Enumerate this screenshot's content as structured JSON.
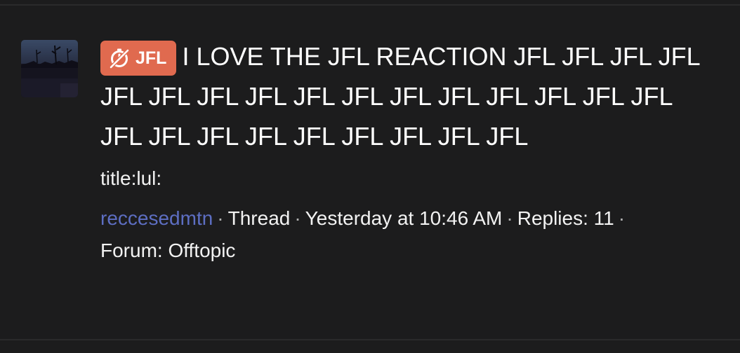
{
  "thread": {
    "prefix": {
      "label": "JFL",
      "icon": "stopwatch-slash-icon",
      "color": "#e06a4f"
    },
    "title": "I LOVE THE JFL REACTION JFL JFL JFL JFL JFL JFL JFL JFL JFL JFL JFL JFL JFL JFL JFL JFL JFL JFL JFL JFL JFL JFL JFL JFL JFL",
    "snippet": "title:lul:",
    "author": "reccesedmtn",
    "type": "Thread",
    "timestamp": "Yesterday at 10:46 AM",
    "replies_label": "Replies: 11",
    "forum_label": "Forum: Offtopic"
  },
  "separator": "·",
  "colors": {
    "background": "#1c1c1d",
    "author_link": "#5d6ec2",
    "text": "#f2f2f2"
  }
}
